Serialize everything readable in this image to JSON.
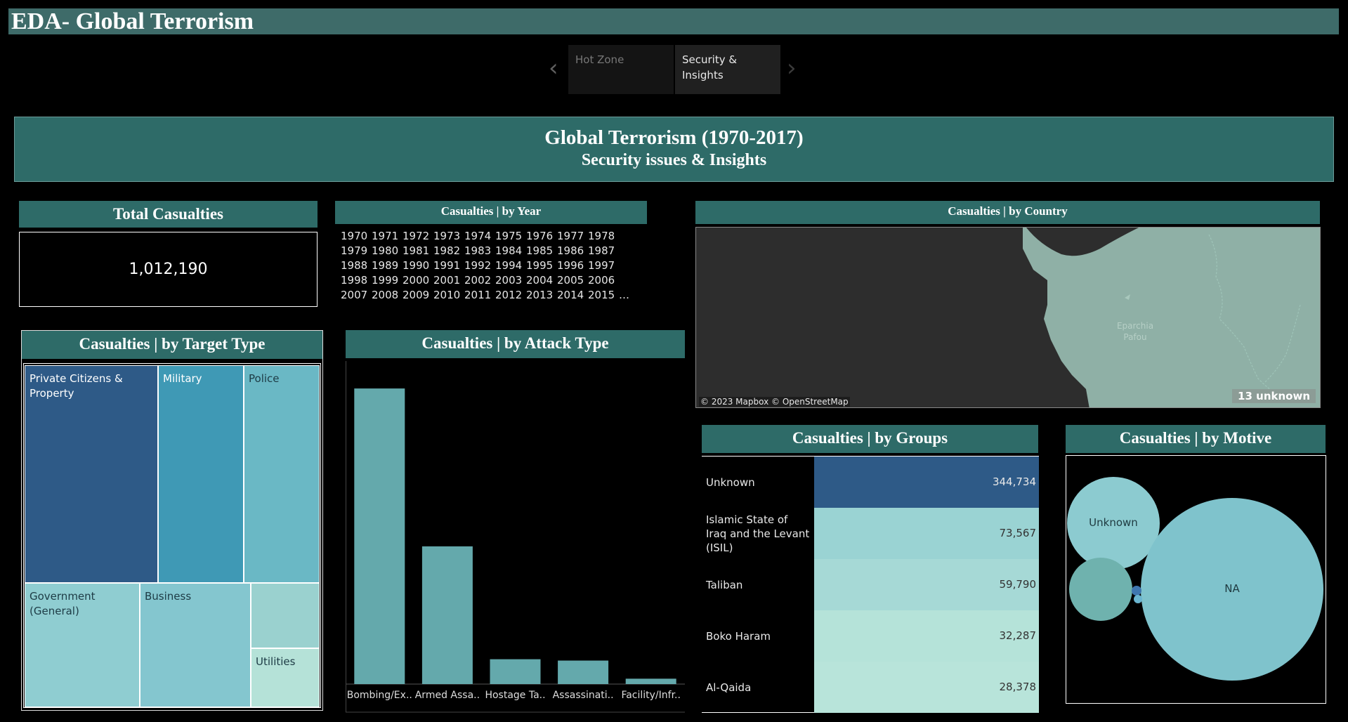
{
  "app": {
    "title": "EDA- Global Terrorism"
  },
  "nav": {
    "tabs": [
      {
        "label": "Hot Zone",
        "active": false
      },
      {
        "label": "Security & Insights",
        "active": true
      }
    ]
  },
  "header": {
    "title": "Global Terrorism (1970-2017)",
    "subtitle": "Security issues & Insights"
  },
  "total_casualties": {
    "title": "Total Casualties",
    "value": "1,012,190"
  },
  "by_year": {
    "title": "Casualties | by Year",
    "rows": [
      [
        "1970",
        "1971",
        "1972",
        "1973",
        "1974",
        "1975",
        "1976",
        "1977",
        "1978"
      ],
      [
        "1979",
        "1980",
        "1981",
        "1982",
        "1983",
        "1984",
        "1985",
        "1986",
        "1987"
      ],
      [
        "1988",
        "1989",
        "1990",
        "1991",
        "1992",
        "1994",
        "1995",
        "1996",
        "1997"
      ],
      [
        "1998",
        "1999",
        "2000",
        "2001",
        "2002",
        "2003",
        "2004",
        "2005",
        "2006"
      ],
      [
        "2007",
        "2008",
        "2009",
        "2010",
        "2011",
        "2012",
        "2013",
        "2014",
        "2015",
        "…"
      ]
    ]
  },
  "by_country": {
    "title": "Casualties | by Country",
    "attribution": "© 2023 Mapbox © OpenStreetMap",
    "unknown_badge": "13 unknown",
    "map_label": "Eparchia Pafou"
  },
  "by_target": {
    "title": "Casualties | by Target Type",
    "cells": [
      {
        "label": "Private Citizens & Property",
        "color": "#2e5a87"
      },
      {
        "label": "Military",
        "color": "#3f99b5"
      },
      {
        "label": "Police",
        "color": "#6ab8c5"
      },
      {
        "label": "Government (General)",
        "color": "#8fcdd1"
      },
      {
        "label": "Business",
        "color": "#84c6cf"
      },
      {
        "label": "",
        "color": "#9ad1cf"
      },
      {
        "label": "Utilities",
        "color": "#b5e2d8"
      }
    ]
  },
  "by_attack": {
    "title": "Casualties | by Attack Type"
  },
  "by_groups": {
    "title": "Casualties | by Groups",
    "rows": [
      {
        "name": "Unknown",
        "value": "344,734",
        "color": "#2e5a87"
      },
      {
        "name": "Islamic State of Iraq and the Levant (ISIL)",
        "value": "73,567",
        "color": "#9ad3d3"
      },
      {
        "name": "Taliban",
        "value": "59,790",
        "color": "#a6d9d6"
      },
      {
        "name": "Boko Haram",
        "value": "32,287",
        "color": "#b5e3d9"
      },
      {
        "name": "Al-Qaida",
        "value": "28,378",
        "color": "#b8e4da"
      }
    ]
  },
  "by_motive": {
    "title": "Casualties | by Motive",
    "bubbles": [
      {
        "label": "Unknown",
        "color": "#8ccbd0"
      },
      {
        "label": "NA",
        "color": "#7fc3cc"
      },
      {
        "label": "",
        "color": "#6fb2ae"
      }
    ]
  },
  "chart_data": {
    "type": "bar",
    "title": "Casualties | by Attack Type",
    "categories": [
      "Bombing/Ex..",
      "Armed Assa..",
      "Hostage Ta..",
      "Assassinati..",
      "Facility/Infr.."
    ],
    "values": [
      440000,
      205000,
      37000,
      35000,
      8000
    ],
    "ylim": [
      0,
      460000
    ],
    "color": "#64a9ac",
    "grid": false
  }
}
